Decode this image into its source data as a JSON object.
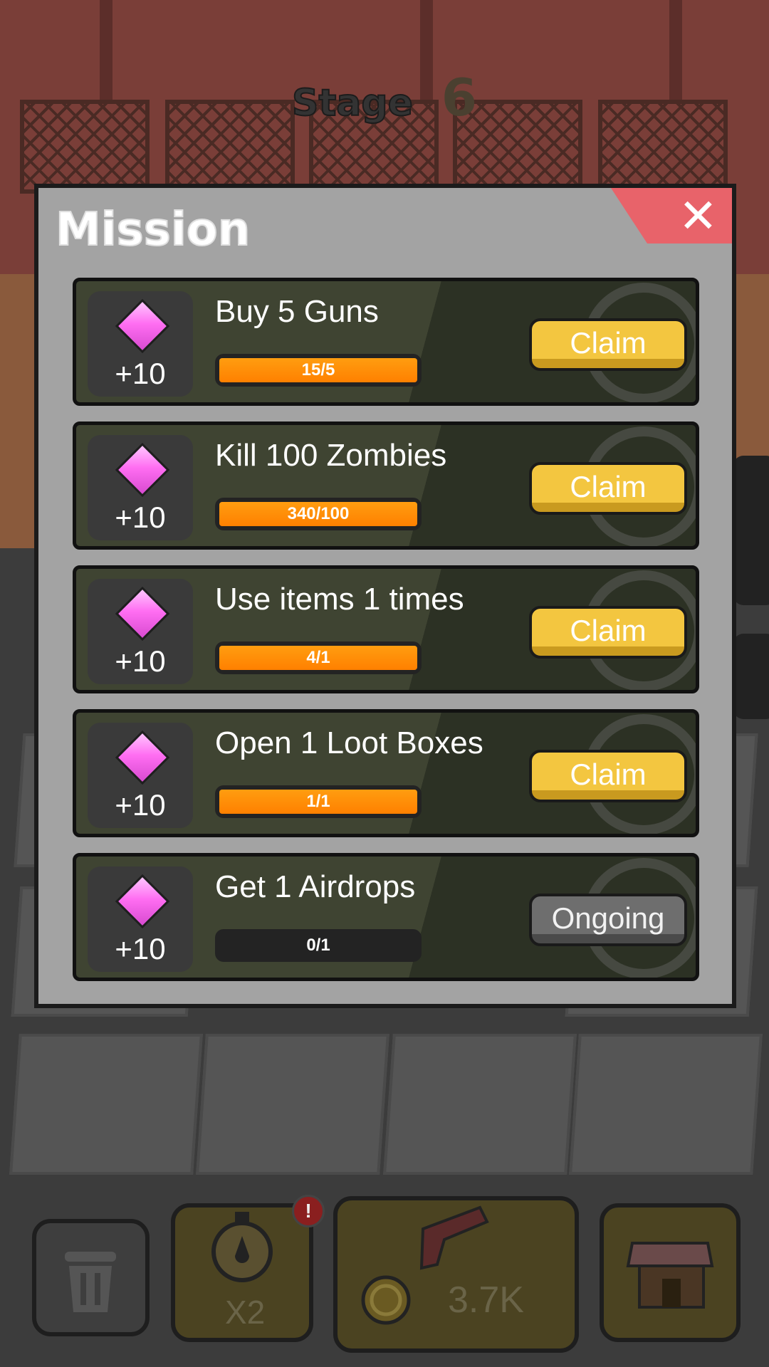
{
  "stage": {
    "label": "Stage",
    "number": "6"
  },
  "panel": {
    "title": "Mission",
    "close_glyph": "✕"
  },
  "missions": [
    {
      "title": "Buy 5 Guns",
      "reward": "+10",
      "progress_text": "15/5",
      "progress": 1.0,
      "button": "Claim",
      "state": "claim"
    },
    {
      "title": "Kill 100 Zombies",
      "reward": "+10",
      "progress_text": "340/100",
      "progress": 1.0,
      "button": "Claim",
      "state": "claim"
    },
    {
      "title": "Use items 1 times",
      "reward": "+10",
      "progress_text": "4/1",
      "progress": 1.0,
      "button": "Claim",
      "state": "claim"
    },
    {
      "title": "Open 1 Loot Boxes",
      "reward": "+10",
      "progress_text": "1/1",
      "progress": 1.0,
      "button": "Claim",
      "state": "claim"
    },
    {
      "title": "Get 1 Airdrops",
      "reward": "+10",
      "progress_text": "0/1",
      "progress": 0.0,
      "button": "Ongoing",
      "state": "ongoing"
    }
  ],
  "bottom_bar": {
    "speed_label": "X2",
    "gun_price": "3.7K",
    "alert_badge": "!"
  },
  "icons": {
    "reward": "pink-gem-icon",
    "trash": "trash-can-icon",
    "timer": "stopwatch-icon",
    "gun": "pistol-icon",
    "coin": "coin-icon",
    "shop": "shop-icon",
    "close": "close-icon"
  },
  "colors": {
    "claim": "#f3c640",
    "ongoing": "#6e6e6e",
    "progress": "#ff8c00",
    "gem": "#ff6ef2",
    "close": "#e8636a"
  }
}
